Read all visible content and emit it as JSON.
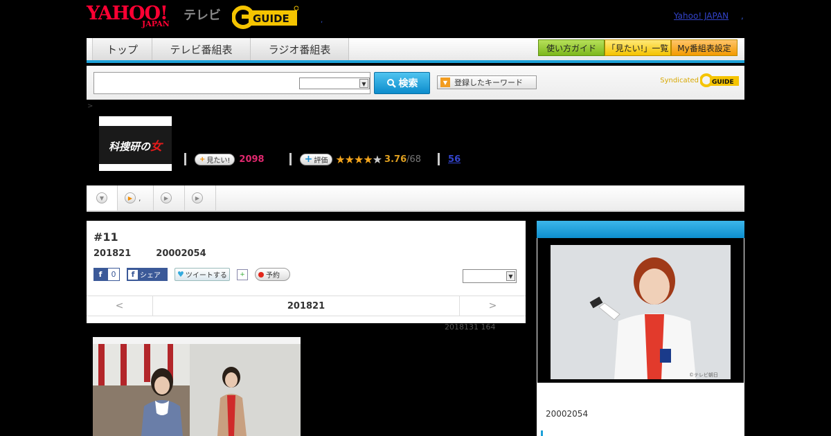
{
  "header": {
    "yahoo_logo": "YAHOO!",
    "yahoo_sub": "JAPAN",
    "tv_label": "テレビ",
    "gguide_logo": "G-GUIDE",
    "dot": ",",
    "yj_link": "Yahoo! JAPAN",
    "yj_dot": ","
  },
  "nav": {
    "tabs": [
      "トップ",
      "テレビ番組表",
      "ラジオ番組表"
    ],
    "right_buttons": [
      "使い方ガイド",
      "「見たい!」一覧",
      "My番組表設定"
    ]
  },
  "search": {
    "input_value": "",
    "select_value": "",
    "button_label": "検索",
    "keyword_button": "登録したキーワード",
    "syndicated": "Syndicated"
  },
  "breadcrumb": ">",
  "program": {
    "thumb_text": "科捜研の",
    "thumb_accent": "女",
    "want_label": "見たい!",
    "want_count": "2098",
    "rate_label": "評価",
    "stars_on": "★★★★",
    "stars_off": "★",
    "score": "3.76",
    "score_sub": "/68",
    "reviews": "56"
  },
  "subtabs": [
    {
      "icon": "▼",
      "label": ""
    },
    {
      "icon": "▶",
      "label": ","
    },
    {
      "icon": "▶",
      "label": ""
    },
    {
      "icon": "▶",
      "label": ""
    }
  ],
  "episode": {
    "title": "#11",
    "date": "201821",
    "code": "20002054",
    "fb_like": "f",
    "fb_count": "0",
    "fb_share": "シェア",
    "tweet": "ツイートする",
    "record": "予約",
    "select_value": "",
    "pager_prev": "<",
    "pager_mid": "201821",
    "pager_next": ">",
    "update_note": "2018131  164"
  },
  "sidebar": {
    "id": "20002054",
    "copyright": "©テレビ朝日"
  },
  "colors": {
    "accent_blue": "#1da1d8",
    "want_pink": "#e0286e",
    "star_gold": "#f4a51c"
  }
}
